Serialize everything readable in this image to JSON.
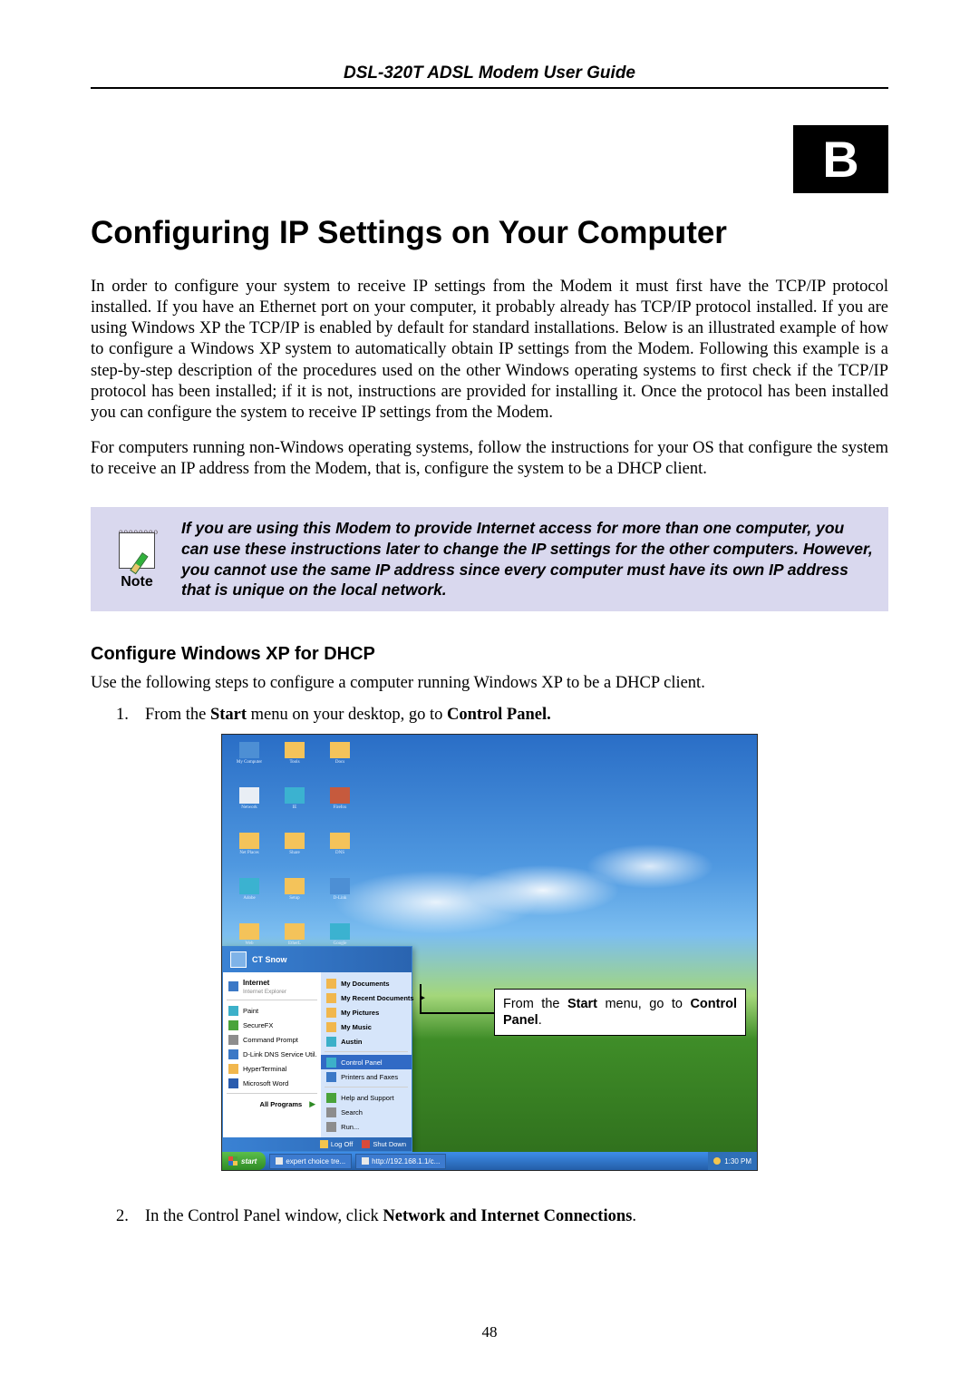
{
  "header": {
    "title": "DSL-320T ADSL Modem User Guide"
  },
  "appendix": {
    "letter": "B"
  },
  "title": "Configuring IP Settings on Your Computer",
  "para1": "In order to configure your system to receive IP settings from the Modem it must first have the TCP/IP protocol installed. If you have an Ethernet port on your computer, it probably already has TCP/IP protocol installed. If you are using Windows XP the TCP/IP is enabled by default for standard installations. Below is an illustrated example of how to configure a Windows XP system to automatically obtain IP settings from the Modem. Following this example is a step-by-step description of the procedures used on the other Windows operating systems to first check if the TCP/IP protocol has been installed; if it is not, instructions are provided for installing it. Once the protocol has been installed you can configure the system to receive IP settings from the Modem.",
  "para2": "For computers running non-Windows operating systems, follow the instructions for your OS that configure the system to receive an IP address from the Modem, that is, configure the system to be a DHCP client.",
  "note": {
    "label": "Note",
    "text": "If you are using this Modem to provide Internet access for more than one computer, you can use these instructions later to change the IP settings for the other computers. However, you cannot use the same IP address since every computer must have its own IP address that is unique on the local network."
  },
  "subheading": "Configure Windows XP for DHCP",
  "subintro": "Use the following steps to configure a computer running Windows XP to be a DHCP client.",
  "steps": [
    {
      "num": "1.",
      "pre": "From the ",
      "b1": "Start",
      "mid": " menu on your desktop, go to ",
      "b2": "Control Panel."
    },
    {
      "num": "2.",
      "pre": "In the Control Panel window, click ",
      "b1": "Network and Internet Connections",
      "post": "."
    }
  ],
  "callout": {
    "pre": "From the ",
    "b1": "Start",
    "mid": " menu, go to ",
    "b2": "Control Panel",
    "post": "."
  },
  "startmenu": {
    "user": "CT Snow",
    "left": [
      {
        "label": "Internet",
        "sub": "Internet Explorer",
        "icon": "blue"
      },
      {
        "label": "Paint",
        "icon": "teal"
      },
      {
        "label": "SecureFX",
        "icon": "green"
      },
      {
        "label": "Command Prompt",
        "icon": "gray"
      },
      {
        "label": "D-Link DNS Service Util.",
        "icon": "blue"
      },
      {
        "label": "HyperTerminal",
        "icon": "orange"
      },
      {
        "label": "Microsoft Word",
        "icon": "word"
      }
    ],
    "allprograms": "All Programs",
    "right": [
      {
        "label": "My Documents",
        "icon": "orange"
      },
      {
        "label": "My Recent Documents",
        "arrow": true,
        "icon": "orange"
      },
      {
        "label": "My Pictures",
        "icon": "orange"
      },
      {
        "label": "My Music",
        "icon": "orange"
      },
      {
        "label": "Austin",
        "icon": "teal"
      },
      {
        "label": "Control Panel",
        "selected": true,
        "icon": "teal"
      },
      {
        "label": "Printers and Faxes",
        "icon": "blue"
      },
      {
        "label": "Help and Support",
        "icon": "green"
      },
      {
        "label": "Search",
        "icon": "gray"
      },
      {
        "label": "Run...",
        "icon": "gray"
      }
    ],
    "footer": {
      "logoff": "Log Off",
      "shutdown": "Shut Down"
    }
  },
  "taskbar": {
    "start": "start",
    "tasks": [
      "expert choice tre...",
      "http://192.168.1.1/c..."
    ],
    "time": "1:30 PM"
  },
  "pagenum": "48"
}
